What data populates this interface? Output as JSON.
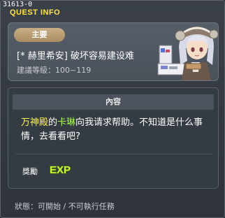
{
  "window": {
    "quest_id": "31613-0",
    "title": "QUEST INFO"
  },
  "header": {
    "type_badge": "主要",
    "quest_name": "[* 赫里希安] 破坏容易建设难",
    "level_requirement": "建議等級：100~119"
  },
  "content": {
    "header": "內容",
    "description": {
      "part1": "万神殿",
      "part2": "的",
      "part3": "卡琳",
      "part4": "向我请求帮助。不知道是什么事情，去看看吧?"
    }
  },
  "reward": {
    "label": "獎勵",
    "icon": "exp-icon",
    "icon_text": "EXP"
  },
  "status": {
    "text": "狀態：可開始 / 不可執行任務"
  },
  "colors": {
    "title": "#ffe34a",
    "badge": "#b89a70",
    "highlight_place": "#fff45a",
    "highlight_npc": "#a8ff4a",
    "exp": "#c6f53a"
  }
}
